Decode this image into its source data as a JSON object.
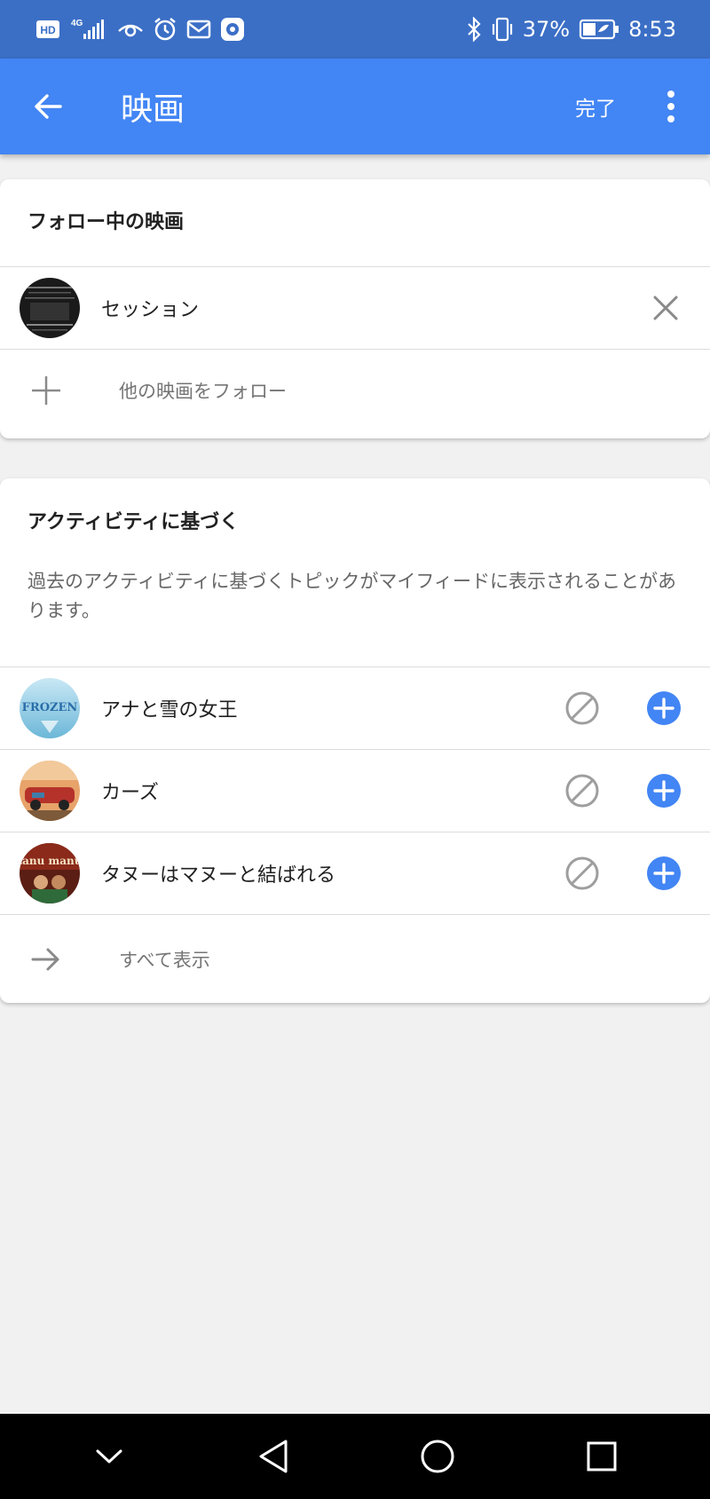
{
  "status_bar": {
    "hd": "HD",
    "network": "4G",
    "battery_pct": "37%",
    "time": "8:53",
    "icons": [
      "hd-icon",
      "signal-icon",
      "eye-icon",
      "alarm-icon",
      "mail-icon",
      "app-icon",
      "bluetooth-icon",
      "vibrate-icon",
      "battery-icon"
    ]
  },
  "app_bar": {
    "title": "映画",
    "done_label": "完了"
  },
  "following": {
    "title": "フォロー中の映画",
    "items": [
      {
        "label": "セッション"
      }
    ],
    "follow_more_label": "他の映画をフォロー"
  },
  "activity": {
    "title": "アクティビティに基づく",
    "description": "過去のアクティビティに基づくトピックがマイフィードに表示されることがあります。",
    "items": [
      {
        "label": "アナと雪の女王",
        "thumb_text": "FROZEN"
      },
      {
        "label": "カーズ"
      },
      {
        "label": "タヌーはマヌーと結ばれる",
        "thumb_text": "tanu manu"
      }
    ],
    "show_all_label": "すべて表示"
  },
  "colors": {
    "status_bar": "#3b6fc6",
    "app_bar": "#4285f4",
    "accent": "#4285f4",
    "background": "#f1f1f1"
  }
}
